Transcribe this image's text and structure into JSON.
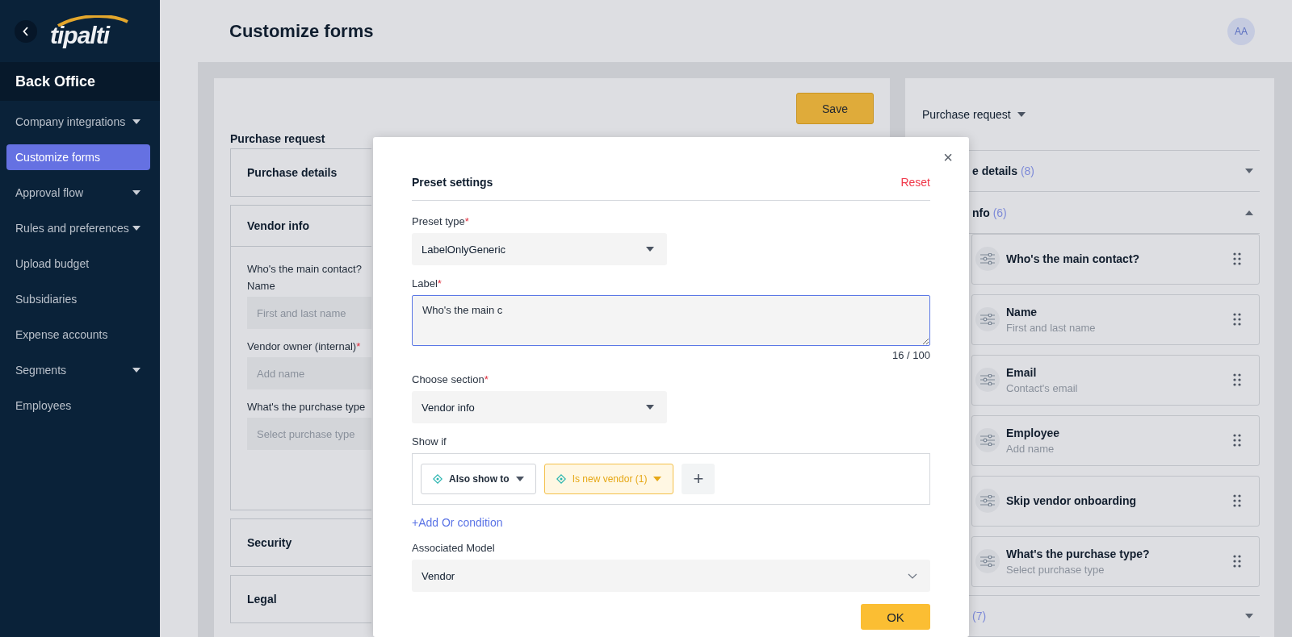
{
  "sidebar": {
    "logo": "tipalti",
    "section": "Back Office",
    "items": [
      {
        "label": "Company integrations",
        "has_submenu": true,
        "selected": false
      },
      {
        "label": "Customize forms",
        "has_submenu": false,
        "selected": true
      },
      {
        "label": "Approval flow",
        "has_submenu": true,
        "selected": false
      },
      {
        "label": "Rules and preferences",
        "has_submenu": true,
        "selected": false
      },
      {
        "label": "Upload budget",
        "has_submenu": false,
        "selected": false
      },
      {
        "label": "Subsidiaries",
        "has_submenu": false,
        "selected": false
      },
      {
        "label": "Expense accounts",
        "has_submenu": false,
        "selected": false
      },
      {
        "label": "Segments",
        "has_submenu": true,
        "selected": false
      },
      {
        "label": "Employees",
        "has_submenu": false,
        "selected": false
      }
    ]
  },
  "header": {
    "title": "Customize forms",
    "avatar": "AA"
  },
  "editor": {
    "save": "Save",
    "form_title": "Purchase request",
    "sections": [
      {
        "title": "Purchase details",
        "expanded": false
      },
      {
        "title": "Vendor info",
        "expanded": true,
        "fields": [
          {
            "label": "Who's the main contact?"
          },
          {
            "label": "Name",
            "placeholder": "First and last name"
          },
          {
            "label": "Vendor owner (internal)",
            "required_mark": "*",
            "placeholder": "Add name"
          },
          {
            "label": "What's the purchase type",
            "placeholder": "Select purchase type"
          }
        ]
      },
      {
        "title": "Security",
        "expanded": false
      },
      {
        "title": "Legal",
        "expanded": false
      }
    ]
  },
  "preview": {
    "form_select": "Purchase request",
    "groups": [
      {
        "title": "e details",
        "count": "(8)",
        "expanded": false
      },
      {
        "title": "nfo",
        "count": "(6)",
        "expanded": true,
        "items": [
          {
            "title": "Who's the main contact?"
          },
          {
            "title": "Name",
            "hint": "First and last name"
          },
          {
            "title": "Email",
            "hint": "Contact's email"
          },
          {
            "title": "Employee",
            "hint": "Add name"
          },
          {
            "title": "Skip vendor onboarding"
          },
          {
            "title": "What's the purchase type?",
            "hint": "Select purchase type"
          }
        ]
      },
      {
        "count": "(7)",
        "expanded": false
      }
    ]
  },
  "modal": {
    "title": "Preset settings",
    "reset": "Reset",
    "close": "×",
    "fields": [
      {
        "kind": "dropdown",
        "label": "Preset type",
        "required_mark": "*",
        "value": "LabelOnlyGeneric"
      },
      {
        "kind": "textarea",
        "label": "Label",
        "required_mark": "*",
        "value": "Who's the main c",
        "counter": "16 / 100"
      },
      {
        "kind": "dropdown",
        "label": "Choose section",
        "required_mark": "*",
        "value": "Vendor info"
      },
      {
        "kind": "conditions",
        "label": "Show if",
        "chips": [
          {
            "label": "Also show to",
            "active": false
          },
          {
            "label": "Is new vendor (1)",
            "active": true
          }
        ],
        "add": "+",
        "link": "+Add Or condition"
      },
      {
        "kind": "select",
        "label": "Associated Model",
        "value": "Vendor"
      }
    ],
    "ok": "OK"
  }
}
